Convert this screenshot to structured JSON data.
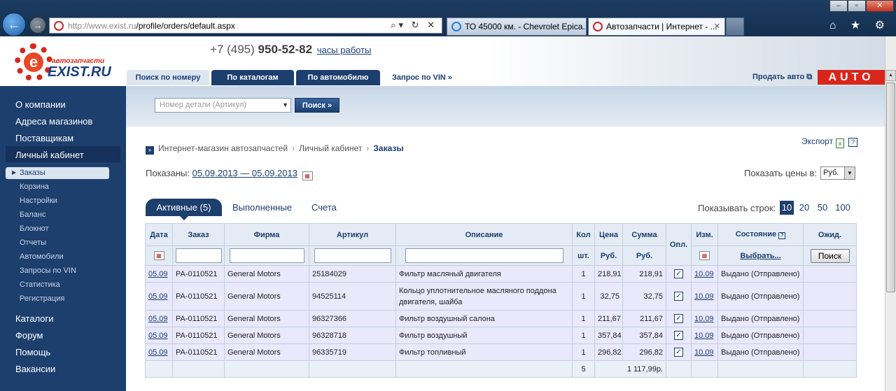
{
  "browser": {
    "url_prefix": "http://www.exist.ru",
    "url_path": "/profile/orders/default.aspx",
    "address_tools": "⌕▾ ↻ ✕",
    "tabs": [
      {
        "label": "ТО 45000 км. - Chevrolet Epica..."
      },
      {
        "label": "Автозапчасти | Интернет - ...",
        "close": "✕"
      }
    ],
    "window_controls": [
      "‒",
      "▫",
      "✕"
    ],
    "tool_icons": "⌂ ★ ⚙"
  },
  "header": {
    "logo_small": "автозапчасти",
    "logo_big": "EXIST.RU",
    "logo_letter": "e",
    "phone_prefix": "+7 (495)",
    "phone_number": "950-52-82",
    "work_hours": "часы работы",
    "search_tabs": [
      "Поиск по номеру",
      "По каталогам",
      "По автомобилю",
      "Запрос по VIN »"
    ],
    "sell_auto": "Продать авто ⧉",
    "auto_label": "AUTO"
  },
  "sidebar": {
    "main_top": [
      "О компании",
      "Адреса магазинов",
      "Поставщикам",
      "Личный кабинет"
    ],
    "sub": [
      "Заказы",
      "Корзина",
      "Настройки",
      "Баланс",
      "Блокнот",
      "Отчеты",
      "Автомобили",
      "Запросы по VIN",
      "Статистика",
      "Регистрация"
    ],
    "main_bottom": [
      "Каталоги",
      "Форум",
      "Помощь",
      "Вакансии"
    ]
  },
  "search": {
    "part_placeholder": "Номер детали (Артикул)",
    "button": "Поиск »"
  },
  "content": {
    "breadcrumb": [
      "Интернет-магазин автозапчастей",
      "Личный кабинет",
      "Заказы"
    ],
    "export_label": "Экспорт",
    "shown_label": "Показаны:",
    "date_range": "05.09.2013 — 05.09.2013",
    "price_label": "Показать цены в:",
    "currency": "Руб.",
    "order_tabs": [
      "Активные (5)",
      "Выполненные",
      "Счета"
    ],
    "rows_label": "Показывать строк:",
    "rows_options": [
      "10",
      "20",
      "50",
      "100"
    ],
    "rows_selected": "10"
  },
  "table": {
    "headers": {
      "date": "Дата",
      "order": "Заказ",
      "firm": "Фирма",
      "article": "Артикул",
      "description": "Описание",
      "qty": "Кол",
      "price": "Цена",
      "sum": "Сумма",
      "paid": "Опл.",
      "changed": "Изм.",
      "status": "Состояние",
      "expected": "Ожид."
    },
    "subheaders": {
      "qty": "шт.",
      "price": "Руб.",
      "sum": "Руб.",
      "status_select": "Выбрать...",
      "filter_button": "Поиск"
    },
    "rows": [
      {
        "date": "05.09",
        "order": "PA-0110521",
        "firm": "General Motors",
        "article": "25184029",
        "description": "Фильтр масляный двигателя",
        "qty": "1",
        "price": "218,91",
        "sum": "218,91",
        "paid": "✓",
        "changed": "10.09",
        "status": "Выдано (Отправлено)"
      },
      {
        "date": "05.09",
        "order": "PA-0110521",
        "firm": "General Motors",
        "article": "94525114",
        "description": "Кольцо уплотнительное масляного поддона двигателя, шайба",
        "qty": "1",
        "price": "32,75",
        "sum": "32,75",
        "paid": "✓",
        "changed": "10.09",
        "status": "Выдано (Отправлено)"
      },
      {
        "date": "05.09",
        "order": "PA-0110521",
        "firm": "General Motors",
        "article": "96327366",
        "description": "Фильтр воздушный салона",
        "qty": "1",
        "price": "211,67",
        "sum": "211,67",
        "paid": "✓",
        "changed": "10.09",
        "status": "Выдано (Отправлено)"
      },
      {
        "date": "05.09",
        "order": "PA-0110521",
        "firm": "General Motors",
        "article": "96328718",
        "description": "Фильтр воздушный",
        "qty": "1",
        "price": "357,84",
        "sum": "357,84",
        "paid": "✓",
        "changed": "10.09",
        "status": "Выдано (Отправлено)"
      },
      {
        "date": "05.09",
        "order": "PA-0110521",
        "firm": "General Motors",
        "article": "96335719",
        "description": "Фильтр топливный",
        "qty": "1",
        "price": "296,82",
        "sum": "296,82",
        "paid": "✓",
        "changed": "10.09",
        "status": "Выдано (Отправлено)"
      }
    ],
    "total_qty": "5",
    "total_sum": "1 117,99р."
  },
  "colors": {
    "brand_dark_blue": "#1d3f6e",
    "brand_red": "#d9261c",
    "row_bg": "#e9e9fb"
  }
}
